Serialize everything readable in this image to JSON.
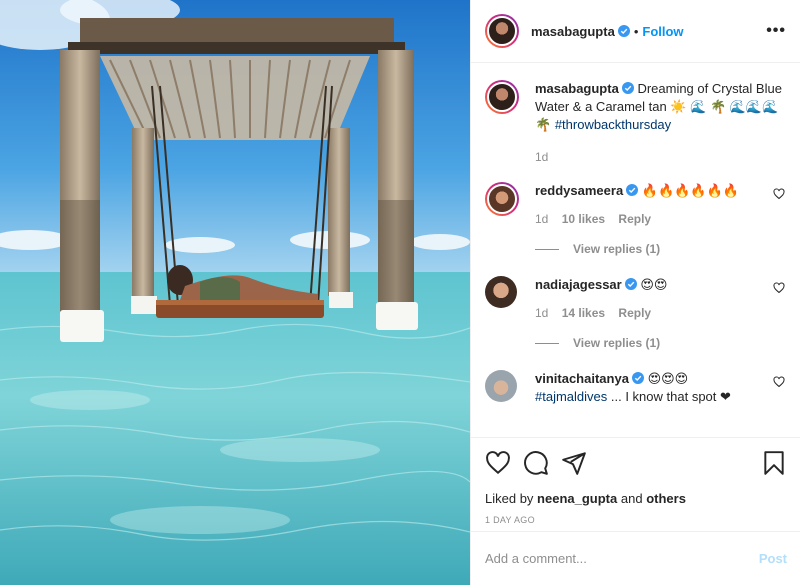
{
  "post": {
    "author": "masabagupta",
    "follow_label": "Follow",
    "dot": "•",
    "more_label": "•••"
  },
  "caption": {
    "author": "masabagupta",
    "text": "Dreaming of Crystal Blue Water & a Caramel tan ☀️ 🌊 🌴 🌊🌊🌊 🌴",
    "hashtag": "#throwbackthursday",
    "time": "1d"
  },
  "comments": [
    {
      "author": "reddysameera",
      "text": "🔥🔥🔥🔥🔥🔥",
      "time": "1d",
      "likes": "10 likes",
      "reply": "Reply",
      "view_replies": "View replies (1)"
    },
    {
      "author": "nadiajagessar",
      "text": "😍😍",
      "time": "1d",
      "likes": "14 likes",
      "reply": "Reply",
      "view_replies": "View replies (1)"
    },
    {
      "author": "vinitachaitanya",
      "text": "😍😍😍",
      "hashtag": "#tajmaldives",
      "tail": "... I know that spot ❤"
    }
  ],
  "likes_line": {
    "prefix": "Liked by",
    "user": "neena_gupta",
    "and": "and",
    "others": "others"
  },
  "timestamp": "1 DAY AGO",
  "comment_box": {
    "placeholder": "Add a comment...",
    "post_label": "Post"
  },
  "colors": {
    "accent": "#0095f6",
    "verified": "#3897f0",
    "hashtag": "#00376b",
    "muted": "#8e8e8e"
  },
  "icons": [
    "heart-icon",
    "comment-icon",
    "share-icon",
    "bookmark-icon",
    "verified-badge-icon",
    "more-icon"
  ]
}
